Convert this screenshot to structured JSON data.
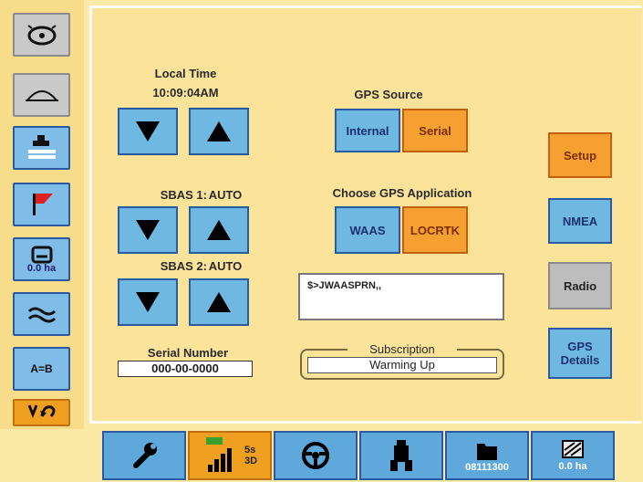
{
  "sidebar": {
    "items": [
      {
        "icon": "steering-wheel-icon"
      },
      {
        "icon": "dome-icon"
      },
      {
        "icon": "tractor-implement-icon"
      },
      {
        "icon": "flag-icon"
      },
      {
        "icon": "area-counter-icon",
        "label": "0.0 ha"
      },
      {
        "icon": "wave-icon"
      },
      {
        "icon": "ab-line-icon",
        "label": "A=B"
      },
      {
        "icon": "undo-icon"
      }
    ]
  },
  "time": {
    "label": "Local Time",
    "value": "10:09:04AM"
  },
  "sbas1": {
    "label": "SBAS 1:",
    "value": "AUTO"
  },
  "sbas2": {
    "label": "SBAS 2:",
    "value": "AUTO"
  },
  "serial": {
    "label": "Serial Number",
    "value": "000-00-0000"
  },
  "gps_source": {
    "label": "GPS Source",
    "options": [
      "Internal",
      "Serial"
    ],
    "selected": "Serial"
  },
  "gps_app": {
    "label": "Choose GPS Application",
    "options": [
      "WAAS",
      "LOCRTK"
    ],
    "selected": "LOCRTK"
  },
  "message": "$>JWAASPRN,,",
  "subscription": {
    "label": "Subscription",
    "status": "Warming Up"
  },
  "right_menu": [
    "Setup",
    "NMEA",
    "Radio",
    "GPS Details"
  ],
  "bottom": {
    "signal": {
      "bars": "4",
      "line1": "5s",
      "line2": "3D"
    },
    "file": "08111300",
    "area": "0.0 ha"
  },
  "colors": {
    "accent": "#f5a030",
    "button": "#6fb8e2",
    "border": "#2b5aa0",
    "panel": "#fbe39a"
  }
}
